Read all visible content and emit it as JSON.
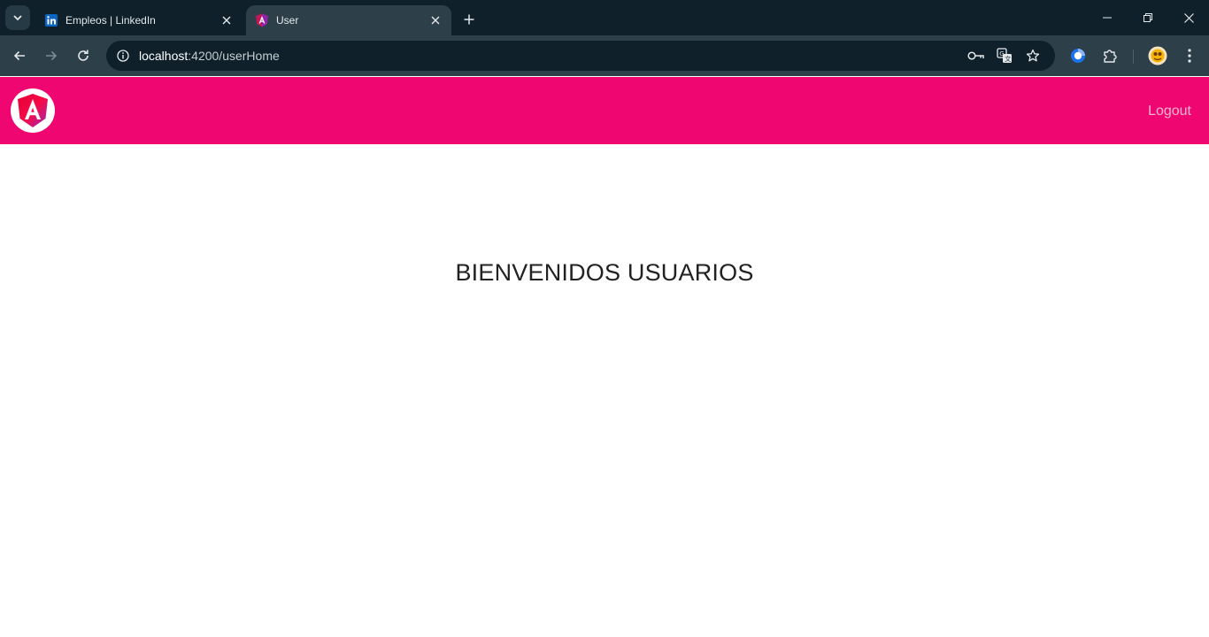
{
  "browser": {
    "tabs": [
      {
        "title": "Empleos | LinkedIn",
        "icon": "linkedin-icon",
        "active": false
      },
      {
        "title": "User",
        "icon": "angular-icon",
        "active": true
      }
    ],
    "url": {
      "host": "localhost",
      "rest": ":4200/userHome"
    }
  },
  "app": {
    "navbar_color": "#ef0670",
    "brand_icon": "angular-logo-icon",
    "logout_label": "Logout"
  },
  "main": {
    "heading": "BIENVENIDOS USUARIOS"
  }
}
